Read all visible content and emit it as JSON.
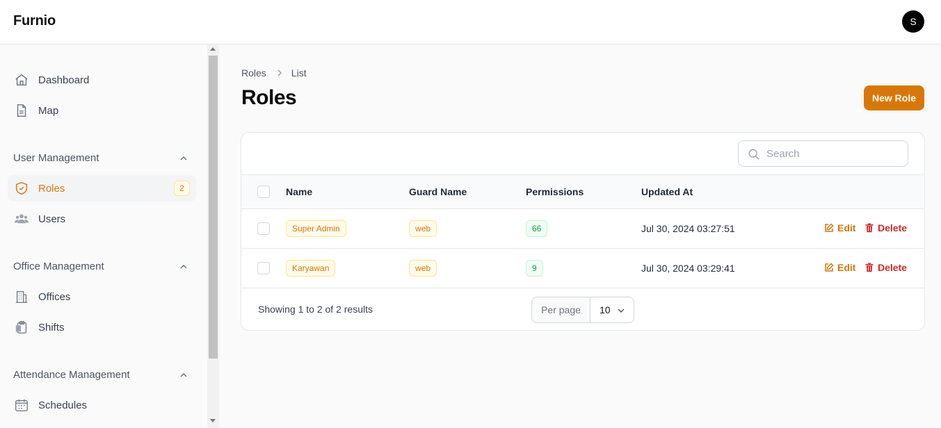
{
  "app": {
    "brand": "Furnio",
    "avatar_initial": "S"
  },
  "sidebar": {
    "top_items": [
      {
        "label": "Dashboard",
        "icon": "home-icon"
      },
      {
        "label": "Map",
        "icon": "document-icon"
      }
    ],
    "groups": [
      {
        "label": "User Management",
        "items": [
          {
            "label": "Roles",
            "icon": "shield-icon",
            "active": true,
            "badge": "2"
          },
          {
            "label": "Users",
            "icon": "users-icon"
          }
        ]
      },
      {
        "label": "Office Management",
        "items": [
          {
            "label": "Offices",
            "icon": "building-icon"
          },
          {
            "label": "Shifts",
            "icon": "clipboard-icon"
          }
        ]
      },
      {
        "label": "Attendance Management",
        "items": [
          {
            "label": "Schedules",
            "icon": "calendar-icon"
          }
        ]
      }
    ]
  },
  "breadcrumb": {
    "items": [
      "Roles",
      "List"
    ]
  },
  "page": {
    "title": "Roles",
    "new_button": "New Role"
  },
  "table": {
    "search_placeholder": "Search",
    "columns": [
      "Name",
      "Guard Name",
      "Permissions",
      "Updated At"
    ],
    "rows": [
      {
        "name": "Super Admin",
        "guard": "web",
        "permissions": "66",
        "updated_at": "Jul 30, 2024 03:27:51"
      },
      {
        "name": "Karyawan",
        "guard": "web",
        "permissions": "9",
        "updated_at": "Jul 30, 2024 03:29:41"
      }
    ],
    "actions": {
      "edit": "Edit",
      "delete": "Delete"
    },
    "footer": {
      "summary": "Showing 1 to 2 of 2 results",
      "per_page_label": "Per page",
      "per_page_value": "10"
    }
  },
  "colors": {
    "accent": "#d97706",
    "danger": "#dc2626",
    "success": "#16a34a"
  }
}
